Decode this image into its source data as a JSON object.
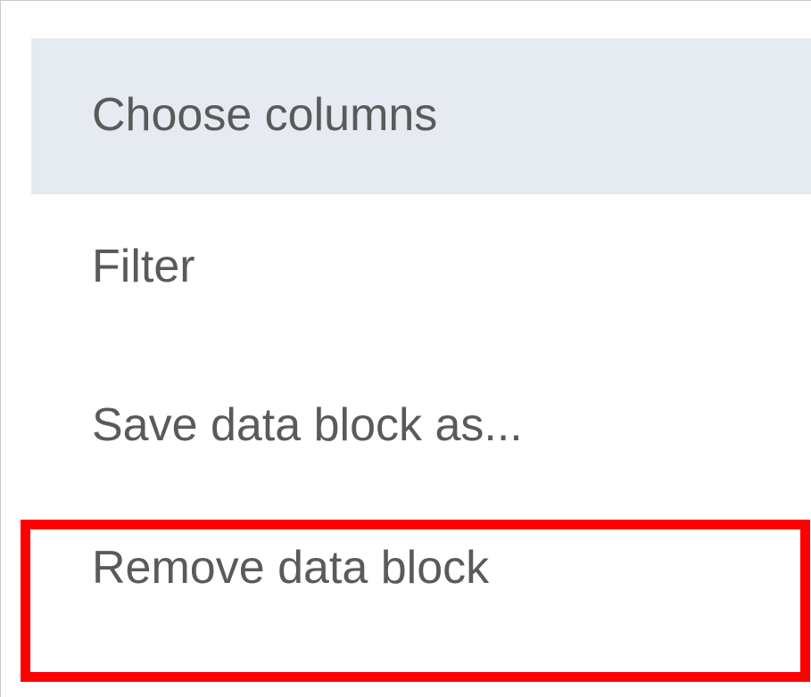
{
  "menu": {
    "items": [
      {
        "label": "Choose columns",
        "state": "hovered"
      },
      {
        "label": "Filter"
      },
      {
        "label": "Save data block as..."
      },
      {
        "label": "Remove data block",
        "annotated": true
      }
    ]
  },
  "colors": {
    "hover_background": "#e6eaf1",
    "text": "#5a5a5a",
    "annotation_border": "#ff0000"
  }
}
